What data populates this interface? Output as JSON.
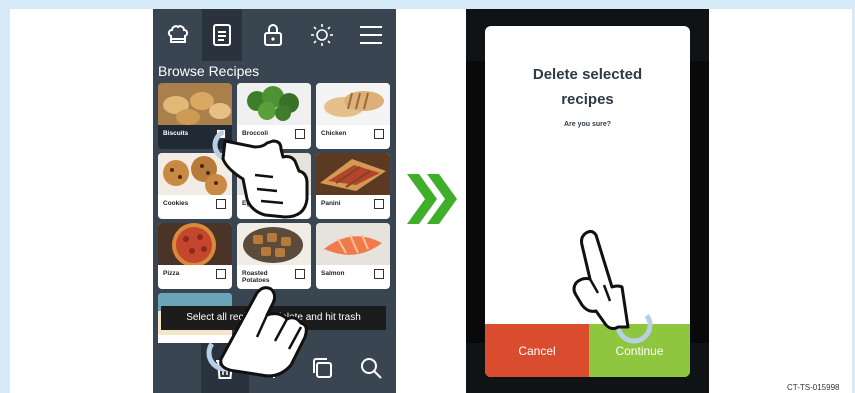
{
  "left_screen": {
    "top_nav": {
      "icons": [
        "chef-hat-icon",
        "recipe-book-icon",
        "lock-icon",
        "brightness-icon",
        "menu-icon"
      ]
    },
    "heading": "Browse Recipes",
    "recipes": [
      {
        "label": "Biscuits",
        "checked": true,
        "checkmark": "✔"
      },
      {
        "label": "Broccoli",
        "checked": false
      },
      {
        "label": "Chicken",
        "checked": false
      },
      {
        "label": "Cookies",
        "checked": false
      },
      {
        "label": "Eggs",
        "checked": false
      },
      {
        "label": "Panini",
        "checked": false
      },
      {
        "label": "Pizza",
        "checked": false
      },
      {
        "label": "Roasted Potatoes",
        "checked": false
      },
      {
        "label": "Salmon",
        "checked": false
      }
    ],
    "toast": "Select all recipes to delete and hit trash",
    "bottom_nav": {
      "icons": [
        "trash-icon",
        "plus-icon",
        "copy-icon",
        "search-icon"
      ]
    }
  },
  "right_screen": {
    "dialog": {
      "title_line1": "Delete selected",
      "title_line2": "recipes",
      "subtitle": "Are you sure?",
      "cancel_label": "Cancel",
      "continue_label": "Continue"
    }
  },
  "document_code": "CT-TS-015998",
  "colors": {
    "frame": "#d6eaf8",
    "app_bg": "#394551",
    "arrow": "#3fae2a",
    "cancel": "#d94c2e",
    "continue": "#8ec63f"
  }
}
